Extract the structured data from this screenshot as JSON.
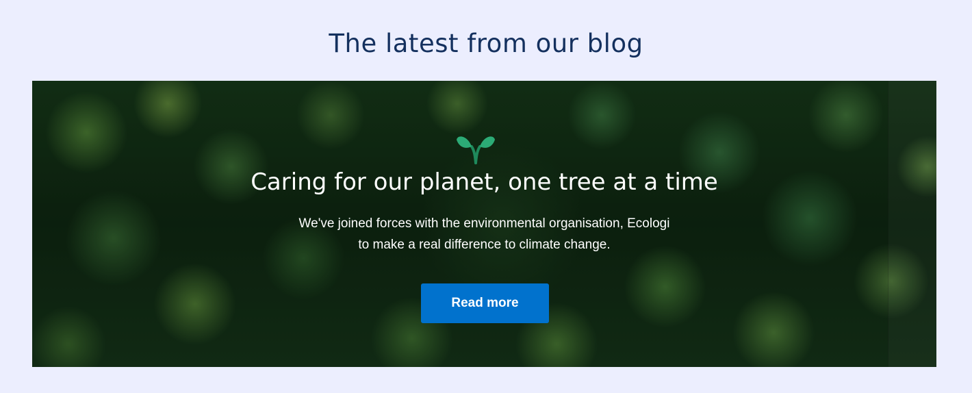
{
  "section": {
    "title": "The latest from our blog"
  },
  "hero": {
    "icon": "sprout-icon",
    "heading": "Caring for our planet, one tree at a time",
    "text_line_1": "We've joined forces with the environmental organisation, Ecologi",
    "text_line_2": "to make a real difference to climate change.",
    "button_label": "Read more"
  },
  "colors": {
    "page_background": "#eceefe",
    "title": "#14305e",
    "button": "#0172cd",
    "sprout": "#26a06e"
  }
}
